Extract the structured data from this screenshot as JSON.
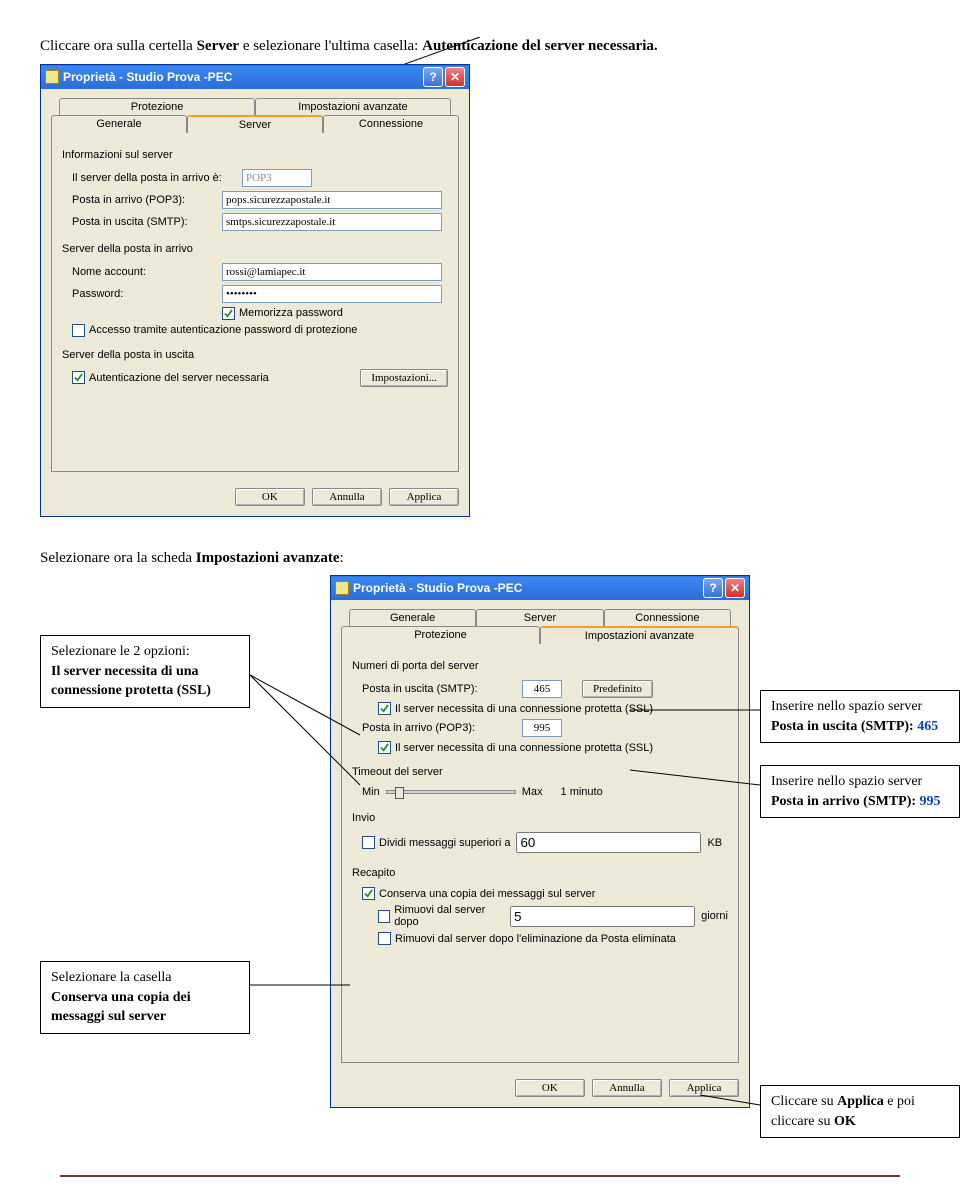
{
  "intro1_a": "Cliccare ora sulla certella ",
  "intro1_b": "Server",
  "intro1_c": " e selezionare l'ultima casella: ",
  "intro1_d": "Autenticazione del server necessaria.",
  "dialog1": {
    "title": "Proprietà - Studio Prova -PEC",
    "help": "?",
    "close": "✕",
    "tabs_back": [
      "Protezione",
      "Impostazioni avanzate"
    ],
    "tabs_front": [
      "Generale",
      "Server",
      "Connessione"
    ],
    "g1": "Informazioni sul server",
    "l_type": "Il server della posta in arrivo è:",
    "v_type": "POP3",
    "l_pop3": "Posta in arrivo (POP3):",
    "v_pop3": "pops.sicurezzapostale.it",
    "l_smtp": "Posta in uscita (SMTP):",
    "v_smtp": "smtps.sicurezzapostale.it",
    "g2": "Server della posta in arrivo",
    "l_acct": "Nome account:",
    "v_acct": "rossi@lamiapec.it",
    "l_pwd": "Password:",
    "v_pwd": "••••••••",
    "cb_remember": "Memorizza password",
    "cb_spa": "Accesso tramite autenticazione password di protezione",
    "g3": "Server della posta in uscita",
    "cb_auth": "Autenticazione del server necessaria",
    "btn_settings": "Impostazioni...",
    "ok": "OK",
    "cancel": "Annulla",
    "apply": "Applica"
  },
  "intro2_a": "Selezionare ora la scheda ",
  "intro2_b": "Impostazioni avanzate",
  "intro2_c": ":",
  "callout_ssl_a": "Selezionare le 2 opzioni:",
  "callout_ssl_b": "Il server necessita di una connessione protetta (SSL)",
  "callout_smtp_a": "Inserire nello spazio server",
  "callout_smtp_b": "Posta in uscita (SMTP): ",
  "callout_smtp_c": "465",
  "callout_pop_a": "Inserire nello spazio server",
  "callout_pop_b": "Posta in arrivo (SMTP): ",
  "callout_pop_c": "995",
  "callout_keep_a": "Selezionare la casella",
  "callout_keep_b": "Conserva una copia dei messaggi sul server",
  "callout_ok_a": "Cliccare su ",
  "callout_ok_b": "Applica",
  "callout_ok_c": " e poi cliccare su ",
  "callout_ok_d": "OK",
  "dialog2": {
    "title": "Proprietà - Studio Prova -PEC",
    "help": "?",
    "close": "✕",
    "tabs_back": [
      "Generale",
      "Server",
      "Connessione"
    ],
    "tabs_front": [
      "Protezione",
      "Impostazioni avanzate"
    ],
    "g1": "Numeri di porta del server",
    "l_smtp": "Posta in uscita (SMTP):",
    "v_smtp": "465",
    "btn_default": "Predefinito",
    "cb_ssl1": "Il server necessita di una connessione protetta (SSL)",
    "l_pop3": "Posta in arrivo (POP3):",
    "v_pop3": "995",
    "cb_ssl2": "Il server necessita di una connessione protetta (SSL)",
    "g2": "Timeout del server",
    "l_min": "Min",
    "l_max": "Max",
    "l_1min": "1 minuto",
    "g3": "Invio",
    "cb_split_a": "Dividi messaggi superiori a",
    "v_split": "60",
    "l_kb": "KB",
    "g4": "Recapito",
    "cb_keep": "Conserva una copia dei messaggi sul server",
    "cb_del_after_a": "Rimuovi dal server dopo",
    "v_days": "5",
    "l_days": "giorni",
    "cb_del_trash": "Rimuovi dal server dopo l'eliminazione da Posta eliminata",
    "ok": "OK",
    "cancel": "Annulla",
    "apply": "Applica"
  }
}
